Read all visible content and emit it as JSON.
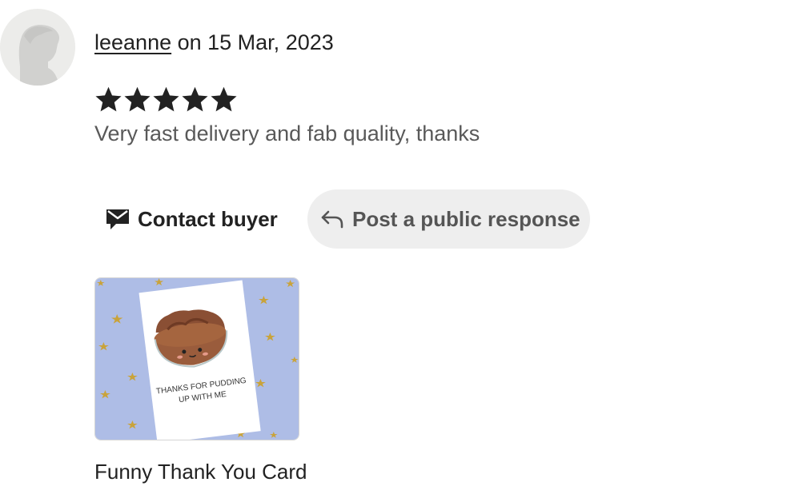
{
  "review": {
    "username": "leeanne",
    "date_text": " on 15 Mar, 2023",
    "rating": 5,
    "rating_max": 5,
    "text": "Very fast delivery and fab quality, thanks"
  },
  "actions": {
    "contact_label": "Contact buyer",
    "contact_icon": "envelope-icon",
    "post_label": "Post a public response",
    "post_icon": "reply-arrow-icon"
  },
  "item": {
    "title": "Funny Thank You Card",
    "card_text_line1": "THANKS FOR PUDDING",
    "card_text_line2": "UP WITH ME"
  },
  "colors": {
    "star": "#222222",
    "thumb_background": "#aebde6",
    "button_secondary_bg": "#eeeeee",
    "muted_text": "#595959"
  }
}
